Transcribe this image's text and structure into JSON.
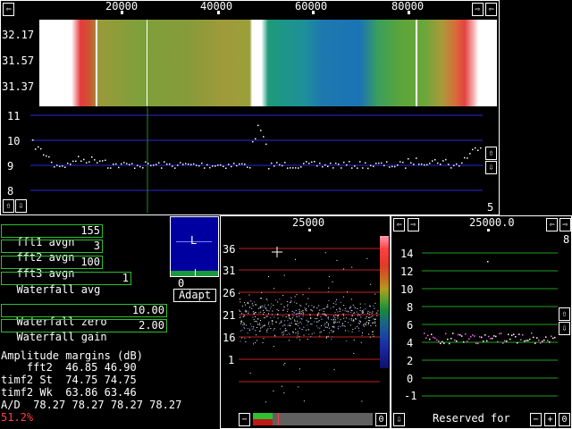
{
  "top": {
    "freq_ticks": [
      "20000",
      "40000",
      "60000",
      "80000"
    ],
    "waterfall_rows": [
      "32.17",
      "31.57",
      "31.37"
    ],
    "spectrum_ticks": [
      "11",
      "10",
      "9",
      "8"
    ],
    "corner_value": "5"
  },
  "params": {
    "fft1_avgn_label": "fft1 avgn",
    "fft1_avgn_value": "155",
    "fft2_avgn_label": "fft2 avgn",
    "fft2_avgn_value": "3",
    "fft3_avgn_label": "fft3 avgn",
    "fft3_avgn_value": "100",
    "wf_avg_label": "Waterfall avg",
    "wf_avg_value": "1",
    "wf_zero_label": "Waterfall zero",
    "wf_zero_value": "10.00",
    "wf_gain_label": "Waterfall gain",
    "wf_gain_value": "2.00"
  },
  "agc": {
    "letter": "L",
    "value": "0",
    "adapt_label": "Adapt"
  },
  "margins": {
    "title": "Amplitude margins (dB)",
    "rows": [
      "    fft2  46.85 46.90",
      "timf2 St  74.75 74.75",
      "timf2 Wk  63.86 63.46",
      "A/D  78.27 78.27 78.27 78.27"
    ],
    "cpu_load": "51.2%"
  },
  "mid_scope": {
    "freq": "25000",
    "ticks": [
      "36",
      "31",
      "26",
      "21",
      "16",
      "1"
    ]
  },
  "right_scope": {
    "freq": "25000.0",
    "ticks": [
      "14",
      "12",
      "10",
      "8",
      "6",
      "4",
      "2",
      "0",
      "-1"
    ],
    "corner_value": "8",
    "status": "Reserved for"
  },
  "colors": {
    "grid_blue": "#2a2ad8",
    "field_green": "#2fbf2f",
    "cpu_red": "#ff4040"
  }
}
